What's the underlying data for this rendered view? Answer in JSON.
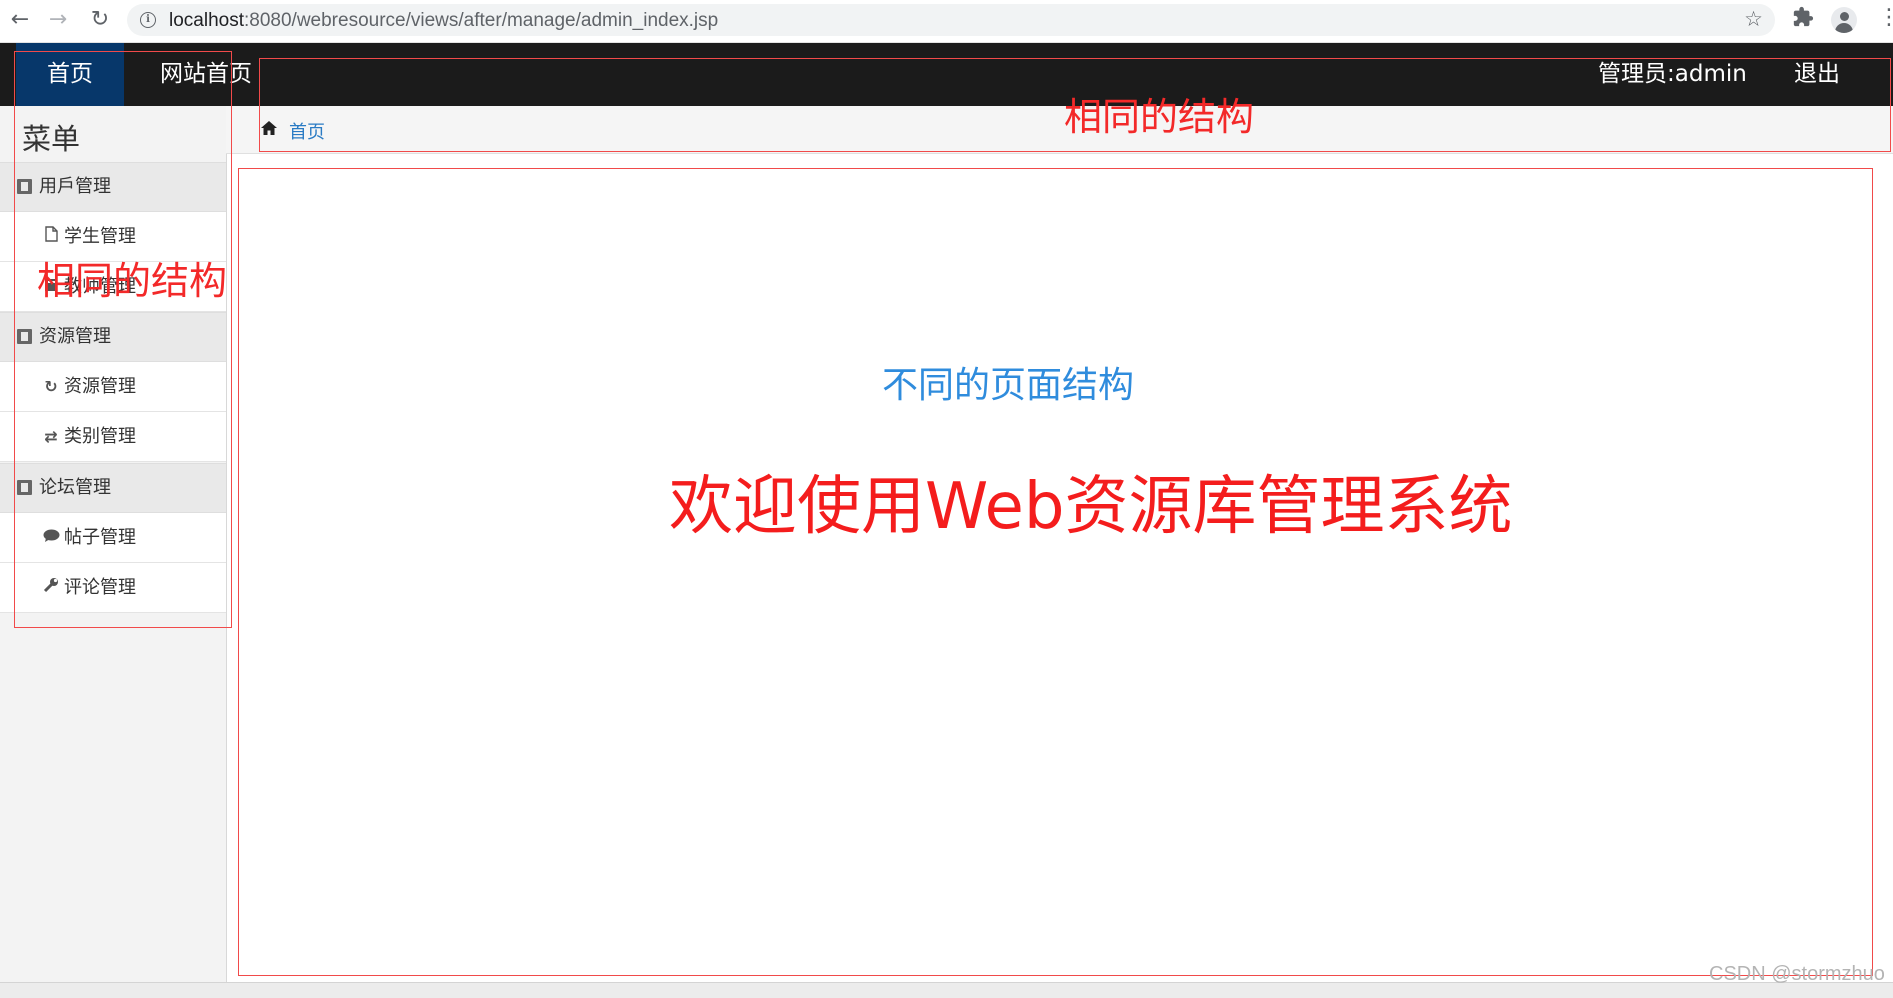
{
  "browser": {
    "url_host": "localhost",
    "url_rest": ":8080/webresource/views/after/manage/admin_index.jsp",
    "icons": [
      "back-arrow-icon",
      "forward-arrow-icon",
      "reload-icon",
      "info-icon",
      "star-icon",
      "puzzle-icon",
      "profile-icon",
      "menu-dots-icon"
    ]
  },
  "navbar": {
    "home": "首页",
    "site_home": "网站首页",
    "admin": "管理员:admin",
    "logout": "退出",
    "colors": {
      "bar": "#1b1b1b",
      "active": "#07376a"
    }
  },
  "sidebar": {
    "title": "菜单",
    "groups": [
      {
        "label": "用戶管理",
        "items": [
          {
            "label": "学生管理",
            "icon": "file-icon"
          },
          {
            "label": "教师管理",
            "icon": "book-icon"
          }
        ]
      },
      {
        "label": "资源管理",
        "items": [
          {
            "label": "资源管理",
            "icon": "refresh-icon"
          },
          {
            "label": "类别管理",
            "icon": "sync-icon"
          }
        ]
      },
      {
        "label": "论坛管理",
        "items": [
          {
            "label": "帖子管理",
            "icon": "comment-icon"
          },
          {
            "label": "评论管理",
            "icon": "wrench-icon"
          }
        ]
      }
    ]
  },
  "breadcrumb": {
    "home": "首页"
  },
  "main": {
    "subtitle": "不同的页面结构",
    "welcome": "欢迎使用Web资源库管理系统"
  },
  "annotations": {
    "top_label": "相同的结构",
    "left_label": "相同的结构",
    "color": "#f14a4a"
  },
  "watermark": "CSDN @stormzhuo"
}
